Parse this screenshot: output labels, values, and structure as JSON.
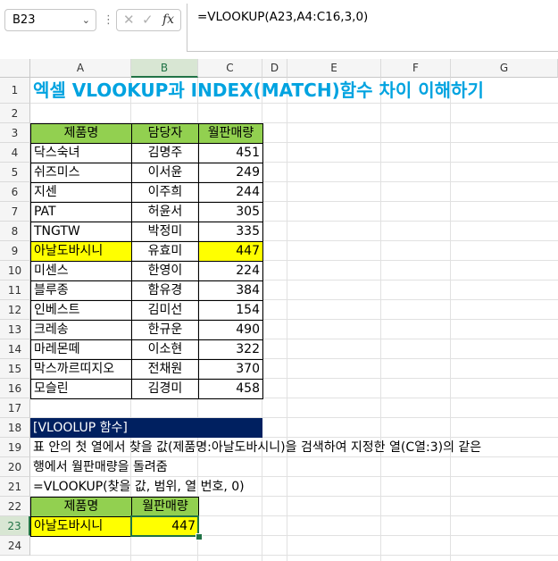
{
  "toolbar": {
    "name_box": "B23",
    "cancel_glyph": "✕",
    "enter_glyph": "✓",
    "fx_label": "fx",
    "formula": "=VLOOKUP(A23,A4:C16,3,0)"
  },
  "columns": [
    "A",
    "B",
    "C",
    "D",
    "E",
    "F",
    "G"
  ],
  "rows": [
    "1",
    "2",
    "3",
    "4",
    "5",
    "6",
    "7",
    "8",
    "9",
    "10",
    "11",
    "12",
    "13",
    "14",
    "15",
    "16",
    "17",
    "18",
    "19",
    "20",
    "21",
    "22",
    "23",
    "24"
  ],
  "title": "엑셀 VLOOKUP과 INDEX(MATCH)함수 차이 이해하기",
  "table": {
    "headers": [
      "제품명",
      "담당자",
      "월판매량"
    ],
    "rows": [
      [
        "닥스숙녀",
        "김명주",
        "451"
      ],
      [
        "쉬즈미스",
        "이서윤",
        "249"
      ],
      [
        "지센",
        "이주희",
        "244"
      ],
      [
        "PAT",
        "허윤서",
        "305"
      ],
      [
        "TNGTW",
        "박정미",
        "335"
      ],
      [
        "아날도바시니",
        "유효미",
        "447"
      ],
      [
        "미센스",
        "한영이",
        "224"
      ],
      [
        "블루종",
        "함유경",
        "384"
      ],
      [
        "인베스트",
        "김미선",
        "154"
      ],
      [
        "크레송",
        "한규운",
        "490"
      ],
      [
        "마레몬떼",
        "이소현",
        "322"
      ],
      [
        "막스까르띠지오",
        "전채원",
        "370"
      ],
      [
        "모슬린",
        "김경미",
        "458"
      ]
    ],
    "highlight_row_index": 5
  },
  "section": {
    "header": "[VLOOLUP 함수]",
    "desc_line1": "표 안의 첫 열에서 찾을 값(제품명:아날도바시니)을 검색하여 지정한 열(C열:3)의 같은",
    "desc_line2": "행에서 월판매량을 돌려줌",
    "syntax": " =VLOOKUP(찾을 값, 범위, 열 번호, 0)"
  },
  "lookup": {
    "headers": [
      "제품명",
      "월판매량"
    ],
    "value": "아날도바시니",
    "result": "447"
  },
  "colors": {
    "header_fill": "#92d050",
    "highlight": "#ffff00",
    "title": "#00a3e0",
    "section_bar": "#002060",
    "selection": "#217346"
  }
}
